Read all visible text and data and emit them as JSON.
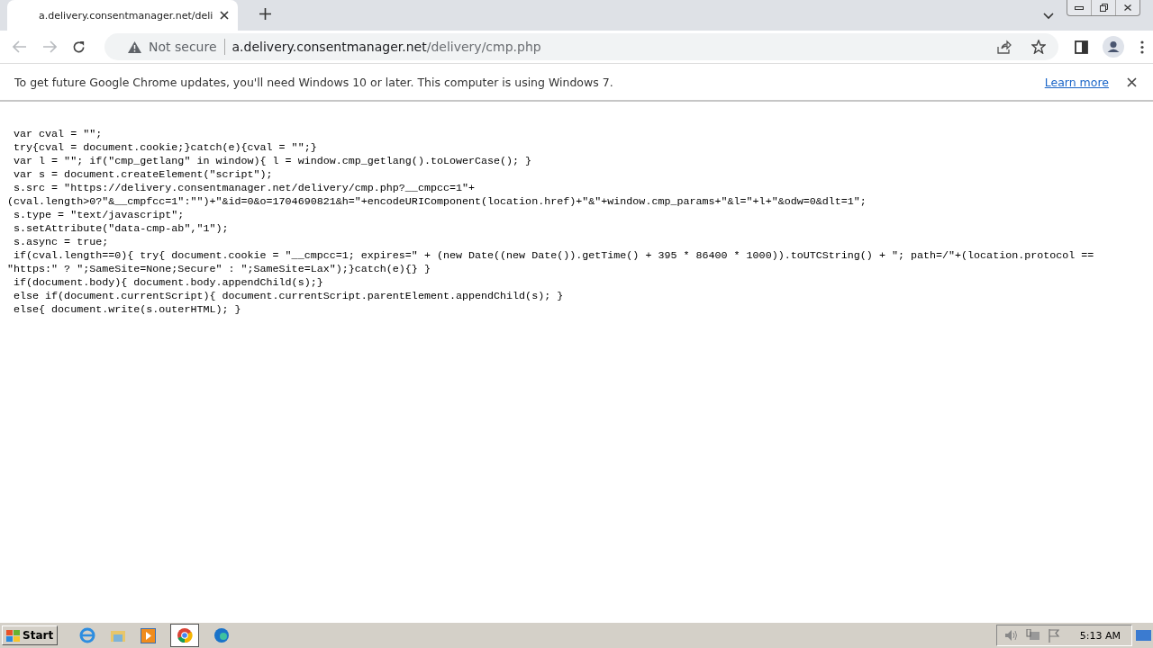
{
  "tabs": [
    {
      "title": "a.delivery.consentmanager.net/deli",
      "selected": true
    }
  ],
  "address_bar": {
    "security": "Not secure",
    "host": "a.delivery.consentmanager.net",
    "path": "/delivery/cmp.php"
  },
  "infobar": {
    "message": "To get future Google Chrome updates, you'll need Windows 10 or later. This computer is using Windows 7.",
    "link": "Learn more"
  },
  "code_lines": [
    " var cval = \"\";",
    " try{cval = document.cookie;}catch(e){cval = \"\";}",
    " var l = \"\"; if(\"cmp_getlang\" in window){ l = window.cmp_getlang().toLowerCase(); }",
    " var s = document.createElement(\"script\");",
    " s.src = \"https://delivery.consentmanager.net/delivery/cmp.php?__cmpcc=1\"+",
    "(cval.length>0?\"&__cmpfcc=1\":\"\")+\"&id=0&o=1704690821&h=\"+encodeURIComponent(location.href)+\"&\"+window.cmp_params+\"&l=\"+l+\"&odw=0&dlt=1\";",
    " s.type = \"text/javascript\";",
    " s.setAttribute(\"data-cmp-ab\",\"1\");",
    " s.async = true;",
    " if(cval.length==0){ try{ document.cookie = \"__cmpcc=1; expires=\" + (new Date((new Date()).getTime() + 395 * 86400 * 1000)).toUTCString() + \"; path=/\"+(location.protocol ==",
    "\"https:\" ? \";SameSite=None;Secure\" : \";SameSite=Lax\");}catch(e){} }",
    " if(document.body){ document.body.appendChild(s);}",
    " else if(document.currentScript){ document.currentScript.parentElement.appendChild(s); }",
    " else{ document.write(s.outerHTML); }"
  ],
  "taskbar": {
    "start": "Start",
    "clock": "5:13 AM"
  }
}
